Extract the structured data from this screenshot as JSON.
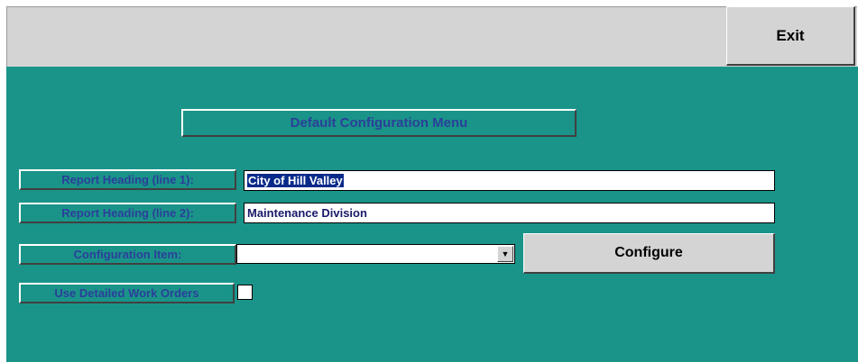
{
  "toolbar": {
    "exit_label": "Exit"
  },
  "form": {
    "title": "Default Configuration Menu",
    "report_heading_1": {
      "label": "Report Heading (line 1):",
      "value": "City of Hill Valley"
    },
    "report_heading_2": {
      "label": "Report Heading (line 2):",
      "value": "Maintenance Division"
    },
    "configuration_item": {
      "label": "Configuration Item:",
      "value": ""
    },
    "configure_button": "Configure",
    "detailed_work_orders": {
      "label": "Use Detailed Work Orders",
      "checked": false
    }
  },
  "colors": {
    "background": "#1a9489",
    "label_text": "#2b3f9a",
    "toolbar": "#d4d4d4"
  }
}
